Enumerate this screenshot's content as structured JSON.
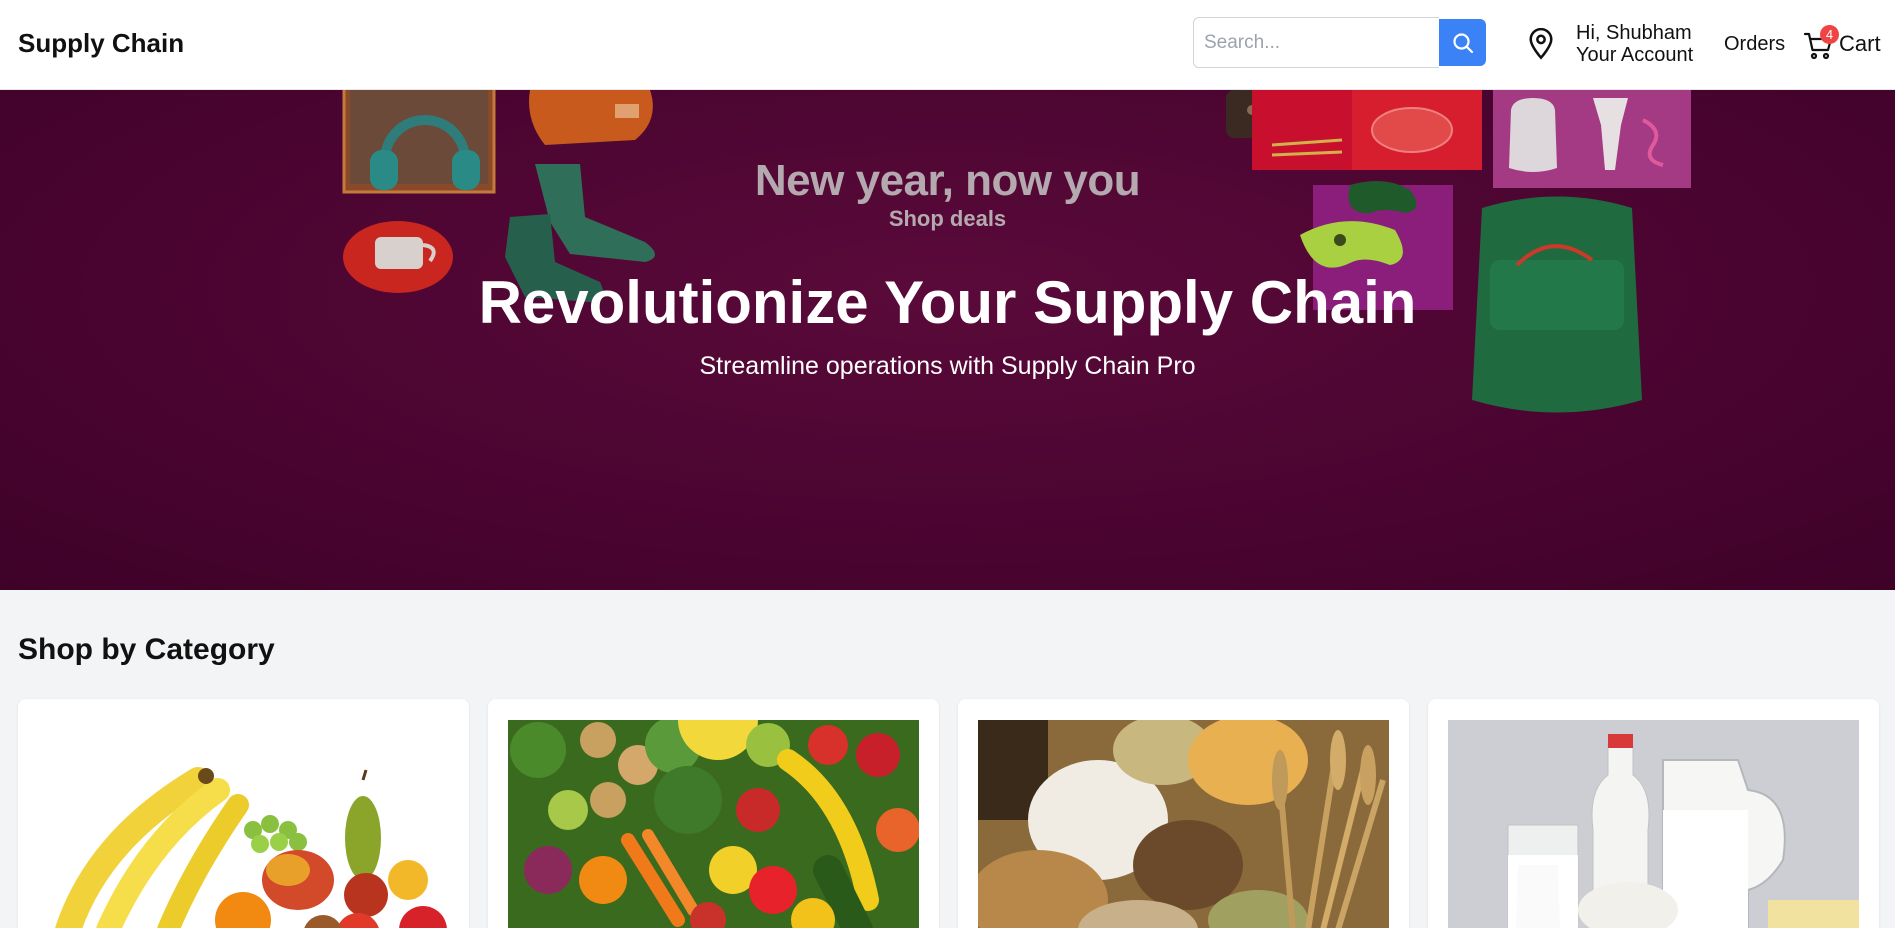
{
  "header": {
    "brand": "Supply Chain",
    "search_placeholder": "Search...",
    "greeting": "Hi, Shubham",
    "account_label": "Your Account",
    "orders_label": "Orders",
    "cart_label": "Cart",
    "cart_count": "4",
    "icons": [
      "search-icon",
      "location-pin-icon",
      "cart-icon"
    ],
    "accent_color": "#3b82f6",
    "badge_color": "#ef4444"
  },
  "hero": {
    "promo_title": "New year, now you",
    "promo_subtitle": "Shop deals",
    "title": "Revolutionize Your Supply Chain",
    "subtitle": "Streamline operations with Supply Chain Pro",
    "background_color": "#4a0430"
  },
  "categories": {
    "title": "Shop by Category",
    "items": [
      {
        "image": "fruits-image"
      },
      {
        "image": "vegetables-image"
      },
      {
        "image": "grains-image"
      },
      {
        "image": "dairy-image"
      }
    ]
  }
}
